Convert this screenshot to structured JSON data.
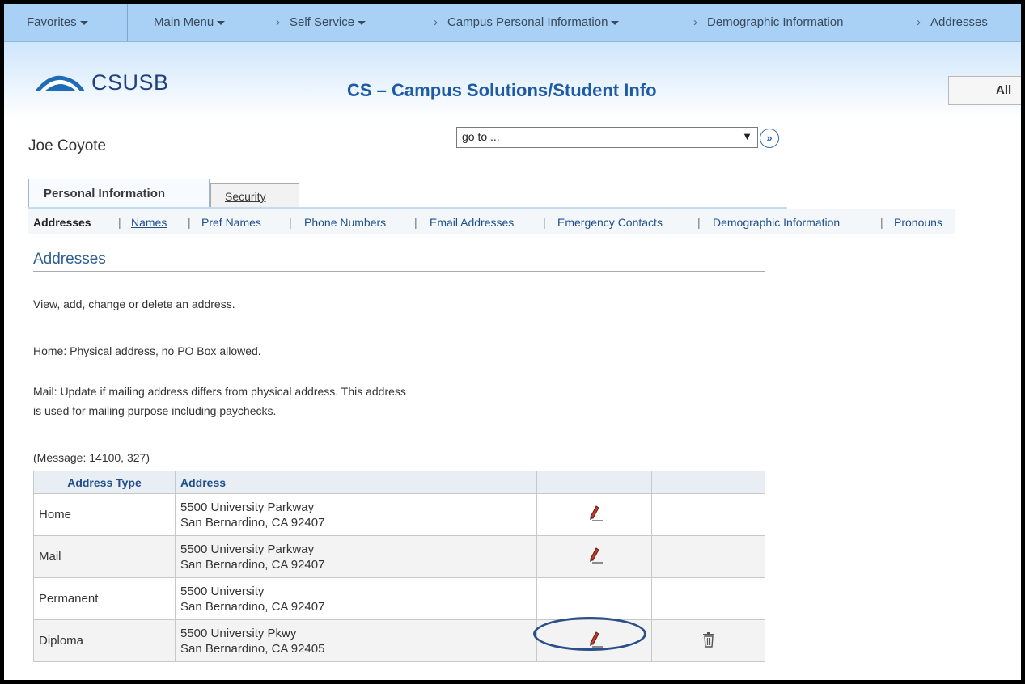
{
  "nav": {
    "favorites": "Favorites",
    "main_menu": "Main Menu",
    "crumbs": [
      "Self Service",
      "Campus Personal Information",
      "Demographic Information",
      "Addresses"
    ]
  },
  "header": {
    "logo_text": "CSUSB",
    "app_title": "CS – Campus Solutions/Student Info",
    "all_label": "All"
  },
  "user": {
    "name": "Joe Coyote"
  },
  "goto": {
    "value": "go to ..."
  },
  "tabs": [
    {
      "label": "Personal Information",
      "active": true
    },
    {
      "label": "Security",
      "active": false
    }
  ],
  "subnav": [
    "Addresses",
    "Names",
    "Pref Names",
    "Phone Numbers",
    "Email Addresses",
    "Emergency Contacts",
    "Demographic Information",
    "Pronouns"
  ],
  "section": {
    "title": "Addresses",
    "intro": "View, add, change or delete an address.",
    "home_note": "Home: Physical address, no PO Box allowed.",
    "mail_note_1": "Mail: Update if mailing address differs from physical address. This address",
    "mail_note_2": "is used for mailing purpose including paychecks.",
    "message": "(Message: 14100, 327)"
  },
  "table": {
    "headers": [
      "Address Type",
      "Address",
      "",
      ""
    ],
    "rows": [
      {
        "type": "Home",
        "line1": "5500 University Parkway",
        "line2": "San Bernardino, CA 92407",
        "edit": true,
        "delete": false
      },
      {
        "type": "Mail",
        "line1": "5500 University Parkway",
        "line2": "San Bernardino, CA 92407",
        "edit": true,
        "delete": false
      },
      {
        "type": "Permanent",
        "line1": "5500 University",
        "line2": "San Bernardino, CA 92407",
        "edit": false,
        "delete": false
      },
      {
        "type": "Diploma",
        "line1": "5500 University Pkwy",
        "line2": "San Bernardino, CA 92405",
        "edit": true,
        "delete": true
      }
    ]
  },
  "colors": {
    "nav_bg": "#a9d0f5",
    "title_blue": "#1f5aa6",
    "link_blue": "#1f4e8c",
    "highlight_ellipse": "#2a4f8a"
  },
  "icons": {
    "edit": "pencil-icon",
    "delete": "trash-icon",
    "go": "double-chevron-right-icon"
  }
}
